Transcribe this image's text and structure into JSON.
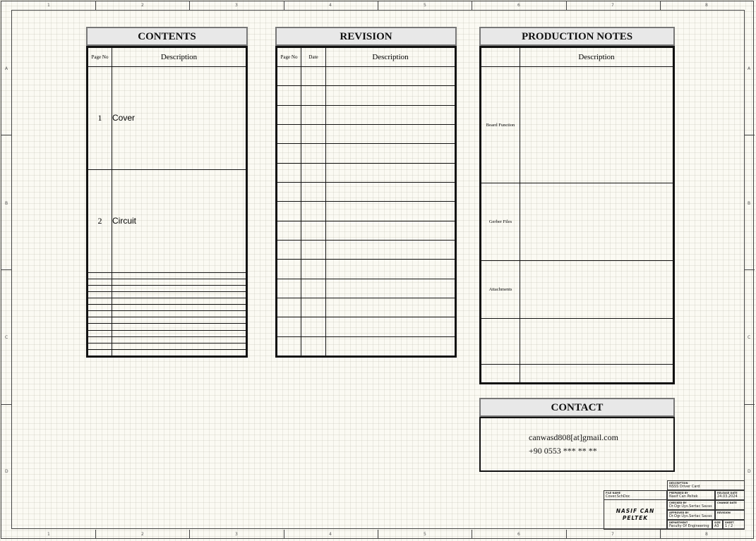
{
  "border": {
    "columns": [
      "1",
      "2",
      "3",
      "4",
      "5",
      "6",
      "7",
      "8"
    ],
    "rows": [
      "A",
      "B",
      "C",
      "D"
    ]
  },
  "contents": {
    "title": "CONTENTS",
    "col_page": "Page No",
    "col_desc": "Description",
    "rows": [
      {
        "page": "1",
        "desc": "Cover"
      },
      {
        "page": "2",
        "desc": "Circuit"
      }
    ]
  },
  "revision": {
    "title": "REVISION",
    "col_page": "Page No",
    "col_date": "Date",
    "col_desc": "Description"
  },
  "production": {
    "title": "PRODUCTION NOTES",
    "col_desc": "Description",
    "labels": [
      "Board Function",
      "Gerber Files",
      "Attachments"
    ]
  },
  "contact": {
    "title": "CONTACT",
    "email": "canwasd808[at]gmail.com",
    "phone": "+90 0553 *** ** **"
  },
  "title_block": {
    "description_label": "DESCRIPTION",
    "description": "NSSS Driver Card",
    "file_name_label": "FILE NAME",
    "file_name": "Cover.SchDoc",
    "prepared_by_label": "PREPARED BY",
    "prepared_by": "Nasif Can Peltek",
    "release_date_label": "RELEASE DATE",
    "release_date": "24.03.2024",
    "checked_by_label": "CHECKED BY",
    "checked_by": "Dr.Ogr.Uys.Sertac Savas",
    "change_date_label": "CHANGE DATE",
    "change_date": "",
    "approved_by_label": "APPROVED BY",
    "approved_by": "Dr.Ogr.Uys.Sertac Savas",
    "revision_label": "REVISION",
    "revision": "",
    "department_label": "DEPARTMENT",
    "department": "Faculty Of Engineering",
    "size_label": "SIZE",
    "size": "A3",
    "sheet_label": "SHEET",
    "sheet": "1 / 2",
    "logo_line1": "NASIF CAN",
    "logo_line2": "PELTEK"
  }
}
